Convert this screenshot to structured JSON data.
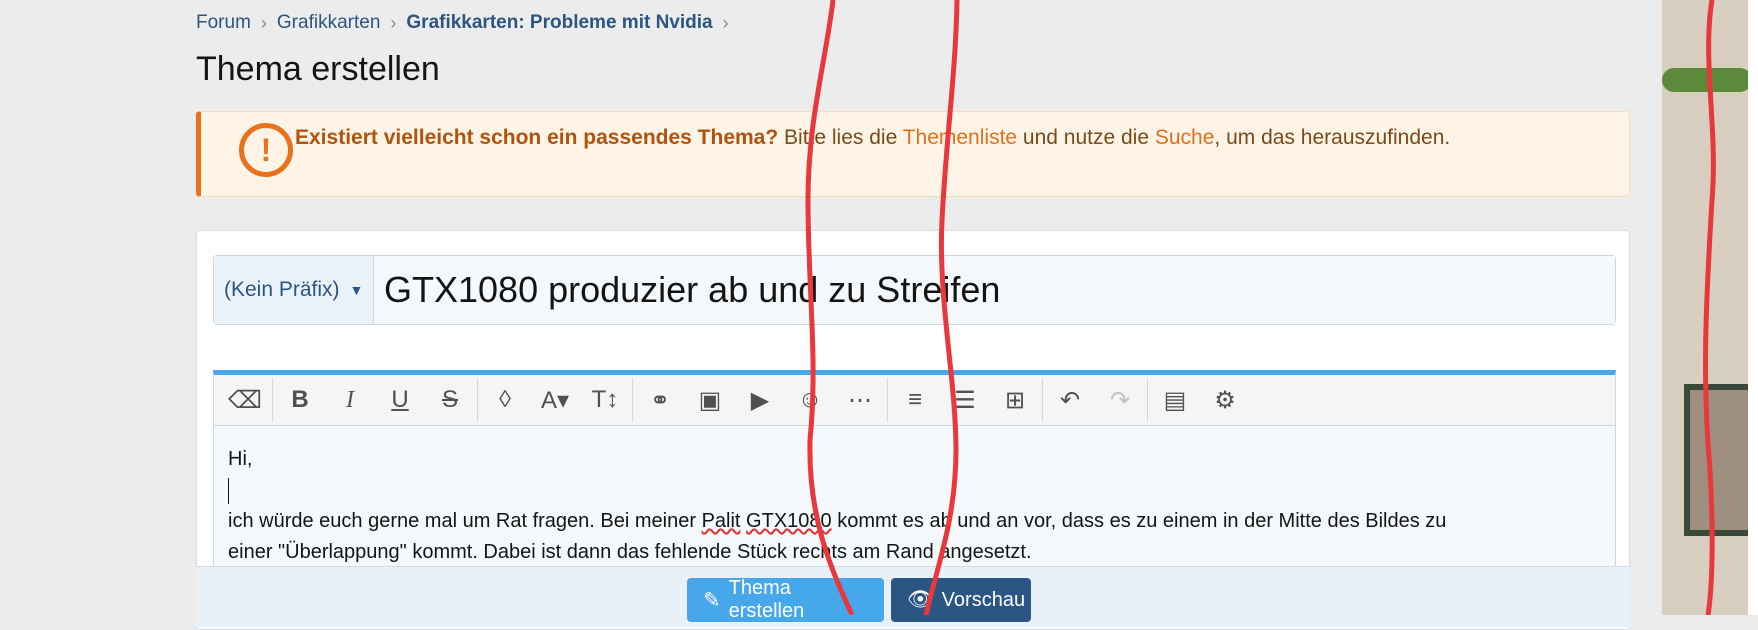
{
  "breadcrumb": {
    "items": [
      "Forum",
      "Grafikkarten"
    ],
    "current": "Grafikkarten: Probleme mit Nvidia"
  },
  "page_title": "Thema erstellen",
  "notice": {
    "icon": "exclamation-circle-icon",
    "bold": "Existiert vielleicht schon ein passendes Thema?",
    "text1": " Bitte lies die ",
    "link1": "Themenliste",
    "text2": " und nutze die ",
    "link2": "Suche",
    "text3": ", um das herauszufinden."
  },
  "form": {
    "prefix_label": "(Kein Präfix)",
    "title_value": "GTX1080 produzier ab und zu Streifen"
  },
  "toolbar": {
    "buttons": [
      "eraser-icon",
      "bold-icon",
      "italic-icon",
      "underline-icon",
      "strikethrough-icon",
      "text-color-icon",
      "font-family-icon",
      "font-size-icon",
      "link-icon",
      "image-icon",
      "video-icon",
      "emoji-icon",
      "more-icon",
      "align-icon",
      "list-icon",
      "table-icon",
      "undo-icon",
      "redo-icon",
      "drafts-icon",
      "settings-icon"
    ]
  },
  "editor": {
    "line1": "Hi,",
    "line3a": "ich würde euch gerne mal um Rat fragen. Bei meiner ",
    "line3_err1": "Palit",
    "line3_space": " ",
    "line3_err2": "GTX1080",
    "line3b": " kommt es ab und an vor, dass es zu einem in der Mitte des Bildes zu",
    "line4": "einer \"Überlappung\" kommt. Dabei ist dann das fehlende Stück rechts am Rand angesetzt."
  },
  "buttons": {
    "create": "Thema erstellen",
    "preview": "Vorschau"
  },
  "colors": {
    "link": "#2b5583",
    "warning": "#e8711e",
    "primary": "#47a7eb",
    "secondary": "#2b5583",
    "scribble": "#e8383d"
  }
}
